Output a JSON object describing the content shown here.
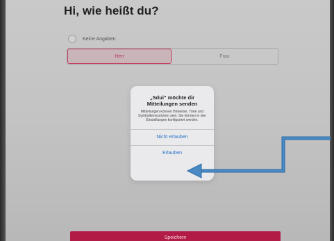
{
  "page": {
    "title": "Hi, wie heißt du?"
  },
  "form": {
    "radio_label": "Keine Angaben",
    "gender_options": [
      "Herr",
      "Frau"
    ],
    "selected": "Herr"
  },
  "alert": {
    "title": "„Sdui“ möchte dir Mitteilungen senden",
    "message": "Mitteilungen können Hinweise, Töne und Symbolkennzeichen sein. Sie können in den Einstellungen konfiguriert werden.",
    "deny_label": "Nicht erlauben",
    "allow_label": "Erlauben"
  },
  "footer": {
    "save_label": "Speichern"
  },
  "colors": {
    "brand": "#b31b47",
    "ios_blue": "#2a74c8",
    "annotation_arrow": "#4a8ac4"
  }
}
